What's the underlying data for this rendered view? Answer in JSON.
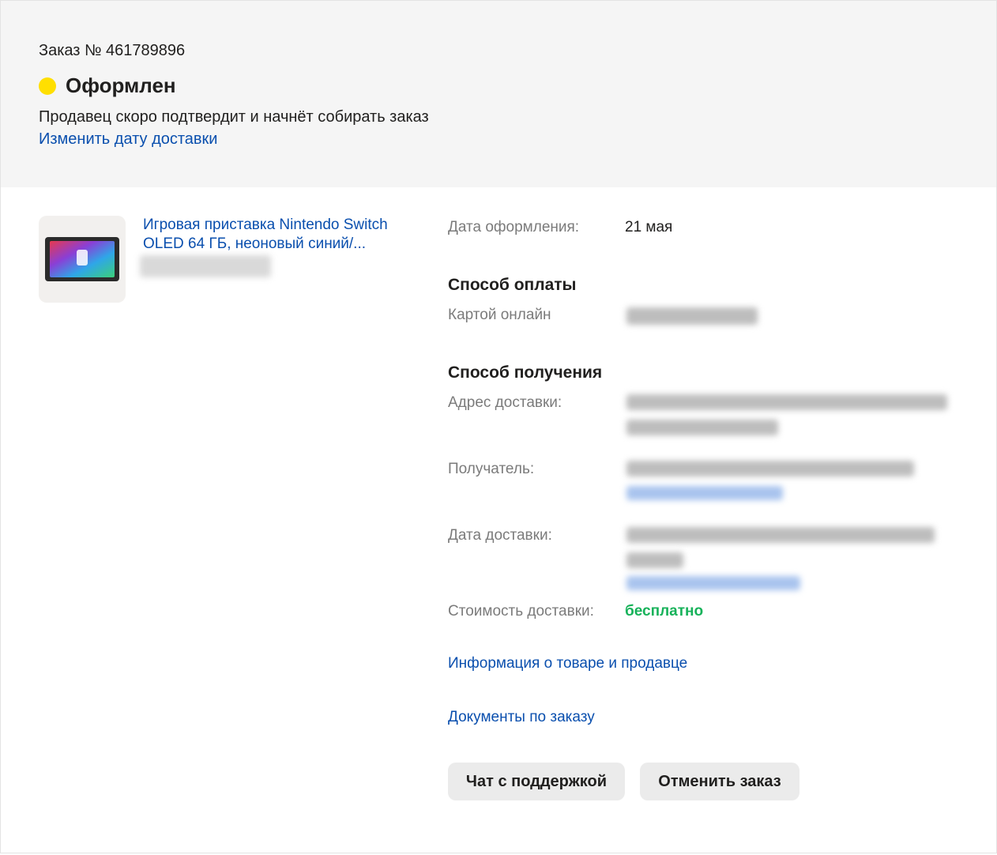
{
  "order": {
    "number_label": "Заказ № 461789896",
    "status": "Оформлен",
    "status_color": "#ffdf00",
    "status_description": "Продавец скоро подтвердит и начнёт собирать заказ",
    "change_date_link": "Изменить дату доставки"
  },
  "product": {
    "title": "Игровая приставка Nintendo Switch OLED 64 ГБ, неоновый синий/...",
    "image_icon": "game-console-icon"
  },
  "details": {
    "order_date_label": "Дата оформления:",
    "order_date_value": "21 мая",
    "payment_title": "Способ оплаты",
    "payment_method": "Картой онлайн",
    "receiving_title": "Способ получения",
    "address_label": "Адрес доставки:",
    "recipient_label": "Получатель:",
    "delivery_date_label": "Дата доставки:",
    "delivery_cost_label": "Стоимость доставки:",
    "delivery_cost_value": "бесплатно"
  },
  "links": {
    "product_seller_info": "Информация о товаре и продавце",
    "order_documents": "Документы по заказу"
  },
  "buttons": {
    "support_chat": "Чат с поддержкой",
    "cancel_order": "Отменить заказ"
  },
  "colors": {
    "link": "#0a4fae",
    "free": "#17b25a",
    "header_bg": "#f5f5f5",
    "button_bg": "#ebebeb"
  }
}
